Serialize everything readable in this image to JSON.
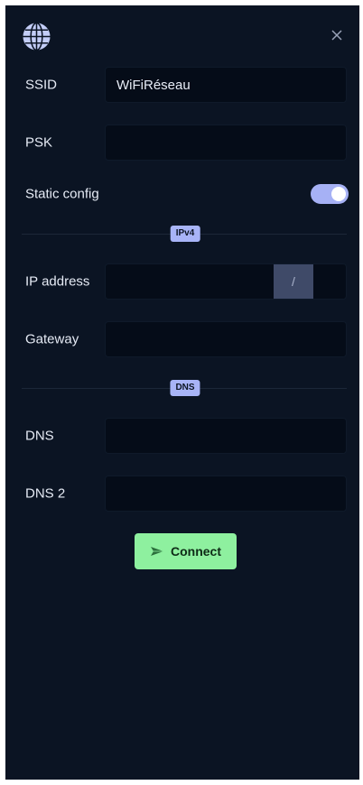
{
  "header": {
    "logo_icon": "globe-icon",
    "close_icon": "close-icon"
  },
  "form": {
    "ssid": {
      "label": "SSID",
      "value": "WiFiRéseau"
    },
    "psk": {
      "label": "PSK",
      "value": ""
    },
    "static_config": {
      "label": "Static config",
      "enabled": true
    },
    "ipv4_section": {
      "label": "IPv4"
    },
    "ip_address": {
      "label": "IP address",
      "value": "",
      "separator": "/",
      "mask": ""
    },
    "gateway": {
      "label": "Gateway",
      "value": ""
    },
    "dns_section": {
      "label": "DNS"
    },
    "dns": {
      "label": "DNS",
      "value": ""
    },
    "dns2": {
      "label": "DNS 2",
      "value": ""
    }
  },
  "actions": {
    "connect_label": "Connect",
    "connect_icon": "send-icon"
  },
  "colors": {
    "panel_bg": "#0b1423",
    "input_bg": "#050c18",
    "accent": "#a6b1f5",
    "connect_bg": "#8ef09f"
  }
}
